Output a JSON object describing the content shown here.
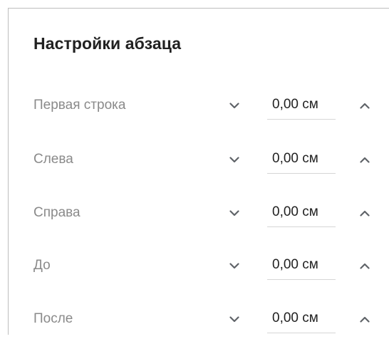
{
  "dialog": {
    "title": "Настройки абзаца"
  },
  "rows": [
    {
      "label": "Первая строка",
      "value": "0,00 см",
      "decrease_icon": "chevron-down-icon",
      "increase_icon": "chevron-up-icon"
    },
    {
      "label": "Слева",
      "value": "0,00 см",
      "decrease_icon": "chevron-down-icon",
      "increase_icon": "chevron-up-icon"
    },
    {
      "label": "Справа",
      "value": "0,00 см",
      "decrease_icon": "chevron-down-icon",
      "increase_icon": "chevron-up-icon"
    },
    {
      "label": "До",
      "value": "0,00 см",
      "decrease_icon": "chevron-down-icon",
      "increase_icon": "chevron-up-icon"
    },
    {
      "label": "После",
      "value": "0,00 см",
      "decrease_icon": "chevron-down-icon",
      "increase_icon": "chevron-up-icon"
    }
  ],
  "colors": {
    "label": "#8a8a8a",
    "value": "#212121",
    "icon": "#5f6368",
    "underline": "#d6d6d6"
  }
}
